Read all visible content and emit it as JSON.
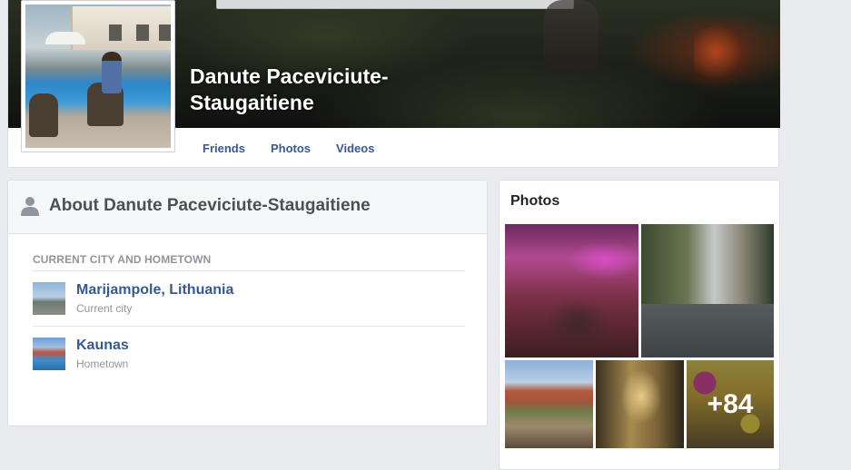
{
  "profile": {
    "name": "Danute Paceviciute-Staugaitiene"
  },
  "nav": {
    "tabs": [
      {
        "label": "Friends"
      },
      {
        "label": "Photos"
      },
      {
        "label": "Videos"
      }
    ]
  },
  "about": {
    "title": "About Danute Paceviciute-Staugaitiene",
    "section_heading": "CURRENT CITY AND HOMETOWN",
    "places": [
      {
        "name": "Marijampole, Lithuania",
        "type": "Current city"
      },
      {
        "name": "Kaunas",
        "type": "Hometown"
      }
    ]
  },
  "photos": {
    "title": "Photos",
    "more_count": "+84"
  }
}
